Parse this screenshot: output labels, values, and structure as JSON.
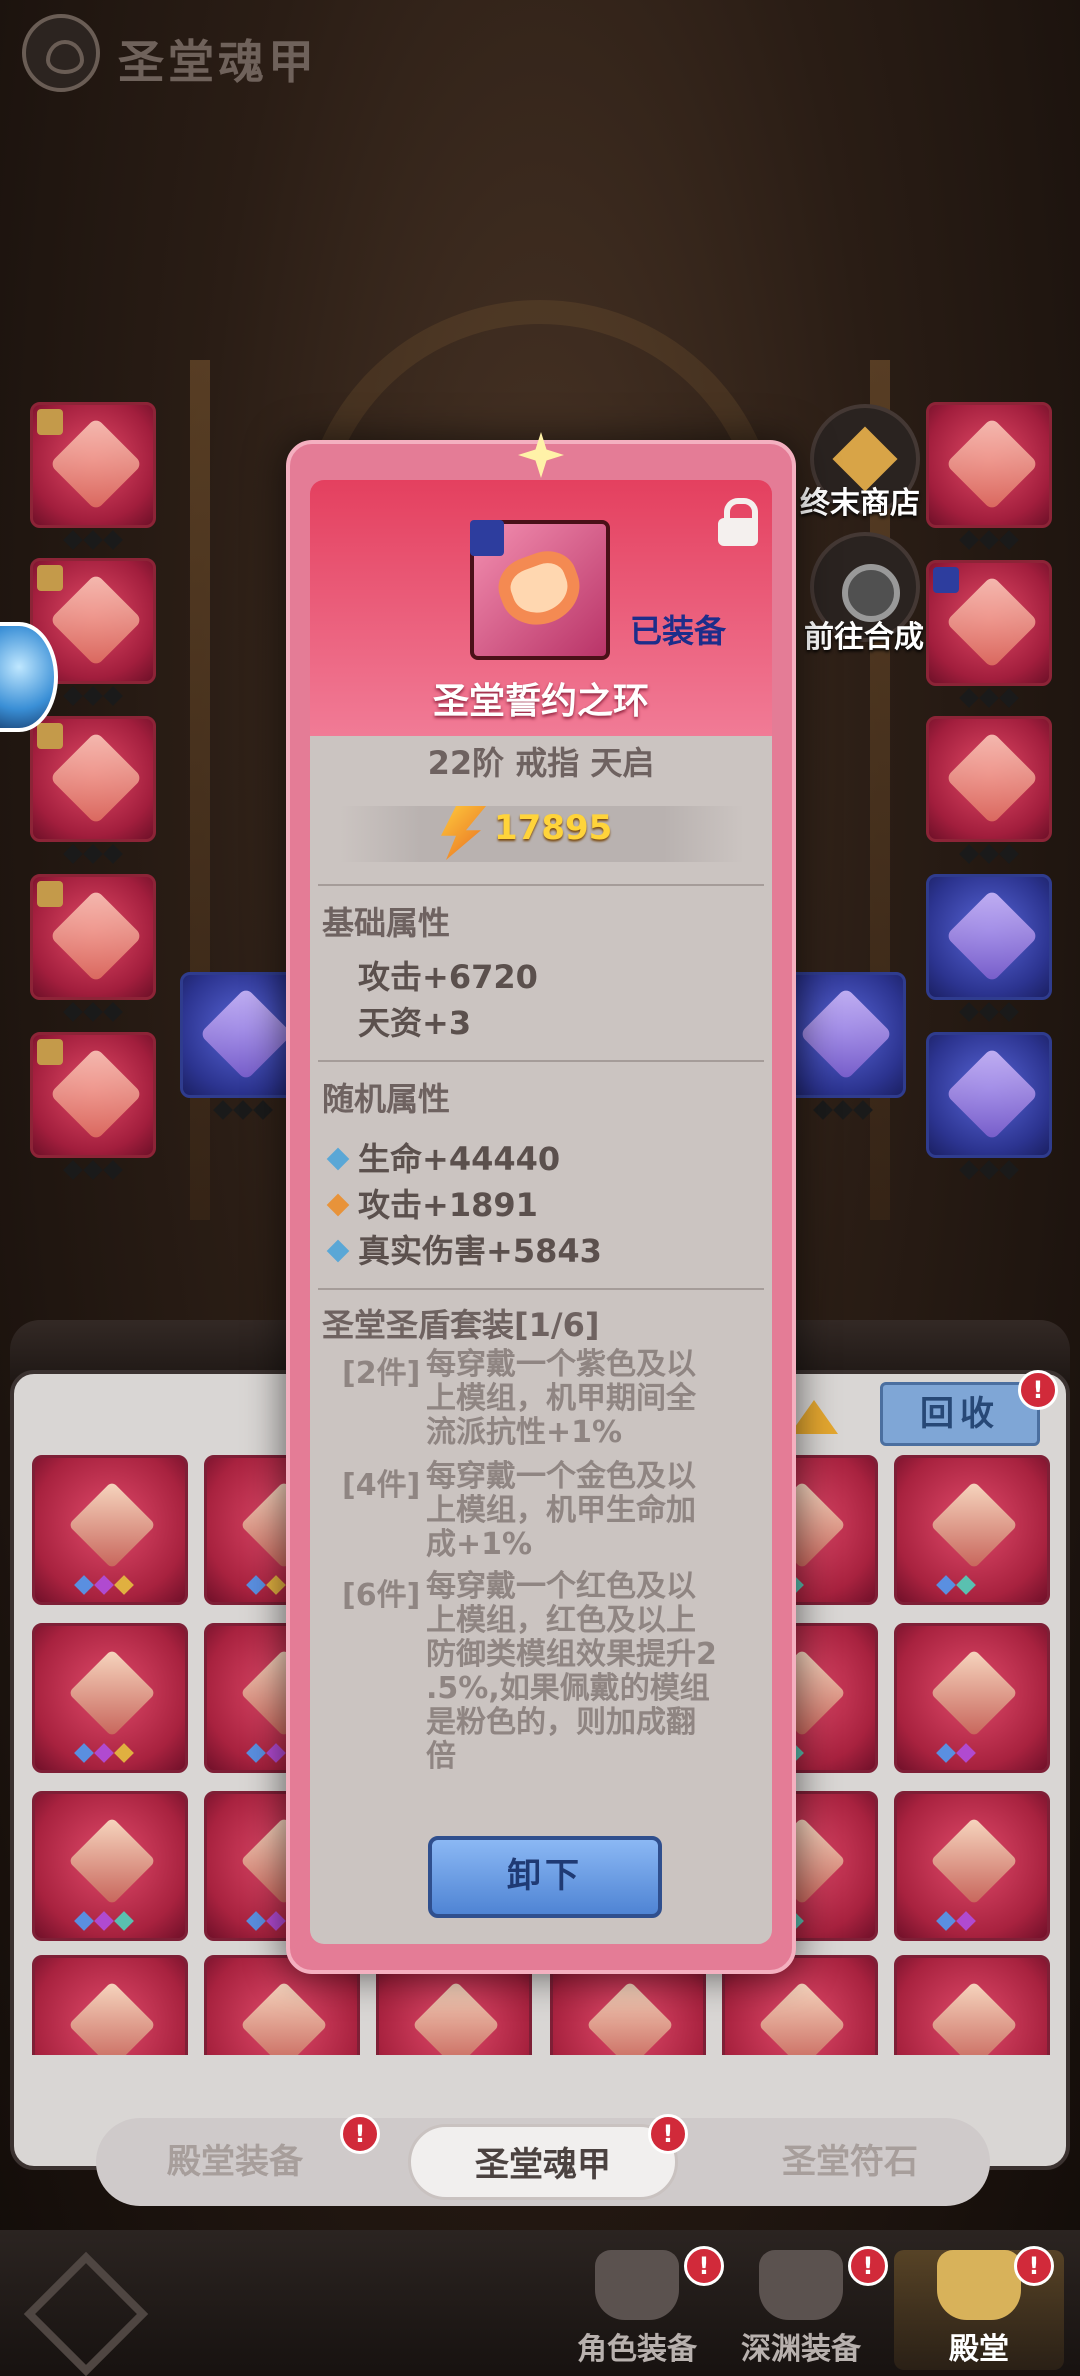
{
  "header": {
    "title": "圣堂魂甲",
    "icon": "helmet-eye-icon"
  },
  "side_buttons": {
    "shop_label": "终末商店",
    "synth_label": "前往合成"
  },
  "modal": {
    "item_name": "圣堂誓约之环",
    "equipped_label": "已装备",
    "meta": "22阶 戒指 天启",
    "power": "17895",
    "base_title": "基础属性",
    "base_stats": [
      "攻击+6720",
      "天资+3"
    ],
    "random_title": "随机属性",
    "random_stats": [
      {
        "text": "生命+44440",
        "color": "#5aa7d6"
      },
      {
        "text": "攻击+1891",
        "color": "#e8933a"
      },
      {
        "text": "真实伤害+5843",
        "color": "#5aa7d6"
      }
    ],
    "set_title": "圣堂圣盾套装[1/6]",
    "set_bonuses": [
      {
        "tag": "[2件]",
        "lines": [
          "每穿戴一个紫色及以",
          "上模组，机甲期间全",
          "流派抗性+1%"
        ]
      },
      {
        "tag": "[4件]",
        "lines": [
          "每穿戴一个金色及以",
          "上模组，机甲生命加",
          "成+1%"
        ]
      },
      {
        "tag": "[6件]",
        "lines": [
          "每穿戴一个红色及以",
          "上模组，红色及以上",
          "防御类模组效果提升2",
          ".5%,如果佩戴的模组",
          "是粉色的，则加成翻",
          "倍"
        ]
      }
    ],
    "unequip_label": "卸下"
  },
  "bag": {
    "recycle_label": "回收"
  },
  "sub_tabs": [
    "殿堂装备",
    "圣堂魂甲",
    "圣堂符石"
  ],
  "nav": [
    "角色装备",
    "深渊装备",
    "殿堂"
  ],
  "colors": {
    "accent_pink": "#e4405f",
    "power_gold": "#ffd43a",
    "badge_red": "#d12a3a"
  }
}
